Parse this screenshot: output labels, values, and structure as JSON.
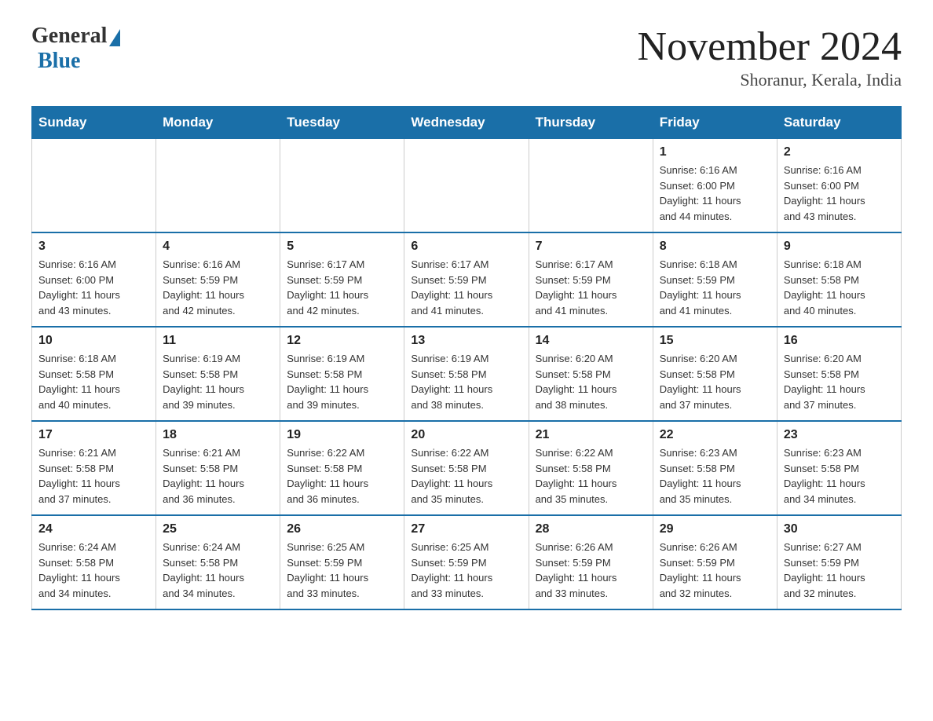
{
  "logo": {
    "general": "General",
    "blue": "Blue"
  },
  "title": "November 2024",
  "location": "Shoranur, Kerala, India",
  "days_of_week": [
    "Sunday",
    "Monday",
    "Tuesday",
    "Wednesday",
    "Thursday",
    "Friday",
    "Saturday"
  ],
  "weeks": [
    [
      {
        "day": "",
        "info": ""
      },
      {
        "day": "",
        "info": ""
      },
      {
        "day": "",
        "info": ""
      },
      {
        "day": "",
        "info": ""
      },
      {
        "day": "",
        "info": ""
      },
      {
        "day": "1",
        "info": "Sunrise: 6:16 AM\nSunset: 6:00 PM\nDaylight: 11 hours\nand 44 minutes."
      },
      {
        "day": "2",
        "info": "Sunrise: 6:16 AM\nSunset: 6:00 PM\nDaylight: 11 hours\nand 43 minutes."
      }
    ],
    [
      {
        "day": "3",
        "info": "Sunrise: 6:16 AM\nSunset: 6:00 PM\nDaylight: 11 hours\nand 43 minutes."
      },
      {
        "day": "4",
        "info": "Sunrise: 6:16 AM\nSunset: 5:59 PM\nDaylight: 11 hours\nand 42 minutes."
      },
      {
        "day": "5",
        "info": "Sunrise: 6:17 AM\nSunset: 5:59 PM\nDaylight: 11 hours\nand 42 minutes."
      },
      {
        "day": "6",
        "info": "Sunrise: 6:17 AM\nSunset: 5:59 PM\nDaylight: 11 hours\nand 41 minutes."
      },
      {
        "day": "7",
        "info": "Sunrise: 6:17 AM\nSunset: 5:59 PM\nDaylight: 11 hours\nand 41 minutes."
      },
      {
        "day": "8",
        "info": "Sunrise: 6:18 AM\nSunset: 5:59 PM\nDaylight: 11 hours\nand 41 minutes."
      },
      {
        "day": "9",
        "info": "Sunrise: 6:18 AM\nSunset: 5:58 PM\nDaylight: 11 hours\nand 40 minutes."
      }
    ],
    [
      {
        "day": "10",
        "info": "Sunrise: 6:18 AM\nSunset: 5:58 PM\nDaylight: 11 hours\nand 40 minutes."
      },
      {
        "day": "11",
        "info": "Sunrise: 6:19 AM\nSunset: 5:58 PM\nDaylight: 11 hours\nand 39 minutes."
      },
      {
        "day": "12",
        "info": "Sunrise: 6:19 AM\nSunset: 5:58 PM\nDaylight: 11 hours\nand 39 minutes."
      },
      {
        "day": "13",
        "info": "Sunrise: 6:19 AM\nSunset: 5:58 PM\nDaylight: 11 hours\nand 38 minutes."
      },
      {
        "day": "14",
        "info": "Sunrise: 6:20 AM\nSunset: 5:58 PM\nDaylight: 11 hours\nand 38 minutes."
      },
      {
        "day": "15",
        "info": "Sunrise: 6:20 AM\nSunset: 5:58 PM\nDaylight: 11 hours\nand 37 minutes."
      },
      {
        "day": "16",
        "info": "Sunrise: 6:20 AM\nSunset: 5:58 PM\nDaylight: 11 hours\nand 37 minutes."
      }
    ],
    [
      {
        "day": "17",
        "info": "Sunrise: 6:21 AM\nSunset: 5:58 PM\nDaylight: 11 hours\nand 37 minutes."
      },
      {
        "day": "18",
        "info": "Sunrise: 6:21 AM\nSunset: 5:58 PM\nDaylight: 11 hours\nand 36 minutes."
      },
      {
        "day": "19",
        "info": "Sunrise: 6:22 AM\nSunset: 5:58 PM\nDaylight: 11 hours\nand 36 minutes."
      },
      {
        "day": "20",
        "info": "Sunrise: 6:22 AM\nSunset: 5:58 PM\nDaylight: 11 hours\nand 35 minutes."
      },
      {
        "day": "21",
        "info": "Sunrise: 6:22 AM\nSunset: 5:58 PM\nDaylight: 11 hours\nand 35 minutes."
      },
      {
        "day": "22",
        "info": "Sunrise: 6:23 AM\nSunset: 5:58 PM\nDaylight: 11 hours\nand 35 minutes."
      },
      {
        "day": "23",
        "info": "Sunrise: 6:23 AM\nSunset: 5:58 PM\nDaylight: 11 hours\nand 34 minutes."
      }
    ],
    [
      {
        "day": "24",
        "info": "Sunrise: 6:24 AM\nSunset: 5:58 PM\nDaylight: 11 hours\nand 34 minutes."
      },
      {
        "day": "25",
        "info": "Sunrise: 6:24 AM\nSunset: 5:58 PM\nDaylight: 11 hours\nand 34 minutes."
      },
      {
        "day": "26",
        "info": "Sunrise: 6:25 AM\nSunset: 5:59 PM\nDaylight: 11 hours\nand 33 minutes."
      },
      {
        "day": "27",
        "info": "Sunrise: 6:25 AM\nSunset: 5:59 PM\nDaylight: 11 hours\nand 33 minutes."
      },
      {
        "day": "28",
        "info": "Sunrise: 6:26 AM\nSunset: 5:59 PM\nDaylight: 11 hours\nand 33 minutes."
      },
      {
        "day": "29",
        "info": "Sunrise: 6:26 AM\nSunset: 5:59 PM\nDaylight: 11 hours\nand 32 minutes."
      },
      {
        "day": "30",
        "info": "Sunrise: 6:27 AM\nSunset: 5:59 PM\nDaylight: 11 hours\nand 32 minutes."
      }
    ]
  ]
}
